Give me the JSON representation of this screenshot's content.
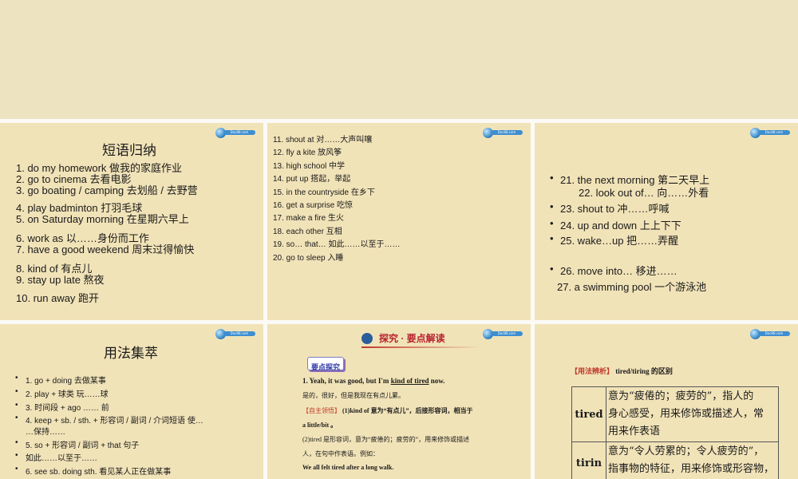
{
  "logo_text": "Doc88.com",
  "slide1": {
    "title": "短语归纳",
    "items": [
      "1. do my homework  做我的家庭作业",
      "2. go to cinema  去看电影",
      "3. go boating / camping  去划船   /  去野营",
      "4. play badminton  打羽毛球",
      "5. on Saturday morning  在星期六早上",
      "6. work as  以……身份而工作",
      "7. have a good weekend  周末过得愉快",
      "8. kind of  有点儿",
      "9. stay up late  熬夜",
      "10. run away  跑开"
    ]
  },
  "slide2": {
    "items": [
      "11. shout at  对……大声叫嚷",
      "12. fly a kite  放风筝",
      "13. high school  中学",
      "14. put up  搭起，举起",
      "15. in the countryside  在乡下",
      "16. get a surprise  吃惊",
      "17. make a fire  生火",
      "18. each other  互相",
      "19. so… that…  如此……以至于……",
      "20. go to sleep  入睡"
    ]
  },
  "slide3": {
    "items": [
      "21. the next morning  第二天早上",
      "22. look out of…  向……外看",
      "23. shout to  冲……呼喊",
      "24. up and down  上上下下",
      "25. wake…up  把……弄醒",
      "26. move into…  移进……",
      "27. a swimming pool  一个游泳池"
    ]
  },
  "slide4": {
    "title": "用法集萃",
    "items": [
      "1. go + doing  去做某事",
      "2. play +  球类  玩……球",
      "3.  时间段 + ago …… 前",
      "4. keep + sb. / sth. +  形容词   /  副词   /  介词短语  使…",
      "…保持……",
      "5. so +  形容词   /  副词 + that  句子",
      "如此……以至于……",
      "6. see sb. doing sth.  看见某人正在做某事"
    ]
  },
  "slide5": {
    "banner": "探究 · 要点解读",
    "tag": "要点探究",
    "sentence_prefix": "1. Yeah, it was good, but I'm ",
    "sentence_underlined": "kind of tired",
    "sentence_suffix": " now.",
    "translation": "是的，很好，但是我现在有点儿累。",
    "note_tag": "【自主领悟】",
    "note1_text": " (1)kind of 意为“有点儿”，后接形容词，相当于",
    "note1_cont": "a little/bit 。",
    "note2": "(2)tired 是形容词，意为“疲倦的；疲劳的”，用来修饰或描述",
    "note2_cont": "人，在句中作表语。例如：",
    "example": "We all felt tired after a long walk."
  },
  "slide6": {
    "heading_tag": "【用法辨析】",
    "heading_text": " tired/tiring 的区别",
    "rows": [
      {
        "word": "tired",
        "desc": [
          "意为“疲倦的；疲劳的”，指人的",
          "身心感受，用来修饰或描述人，常",
          "用来作表语"
        ]
      },
      {
        "word": "tirin",
        "desc": [
          "意为“令人劳累的；令人疲劳的”，",
          "指事物的特征，用来修饰或形容物，"
        ]
      }
    ]
  }
}
